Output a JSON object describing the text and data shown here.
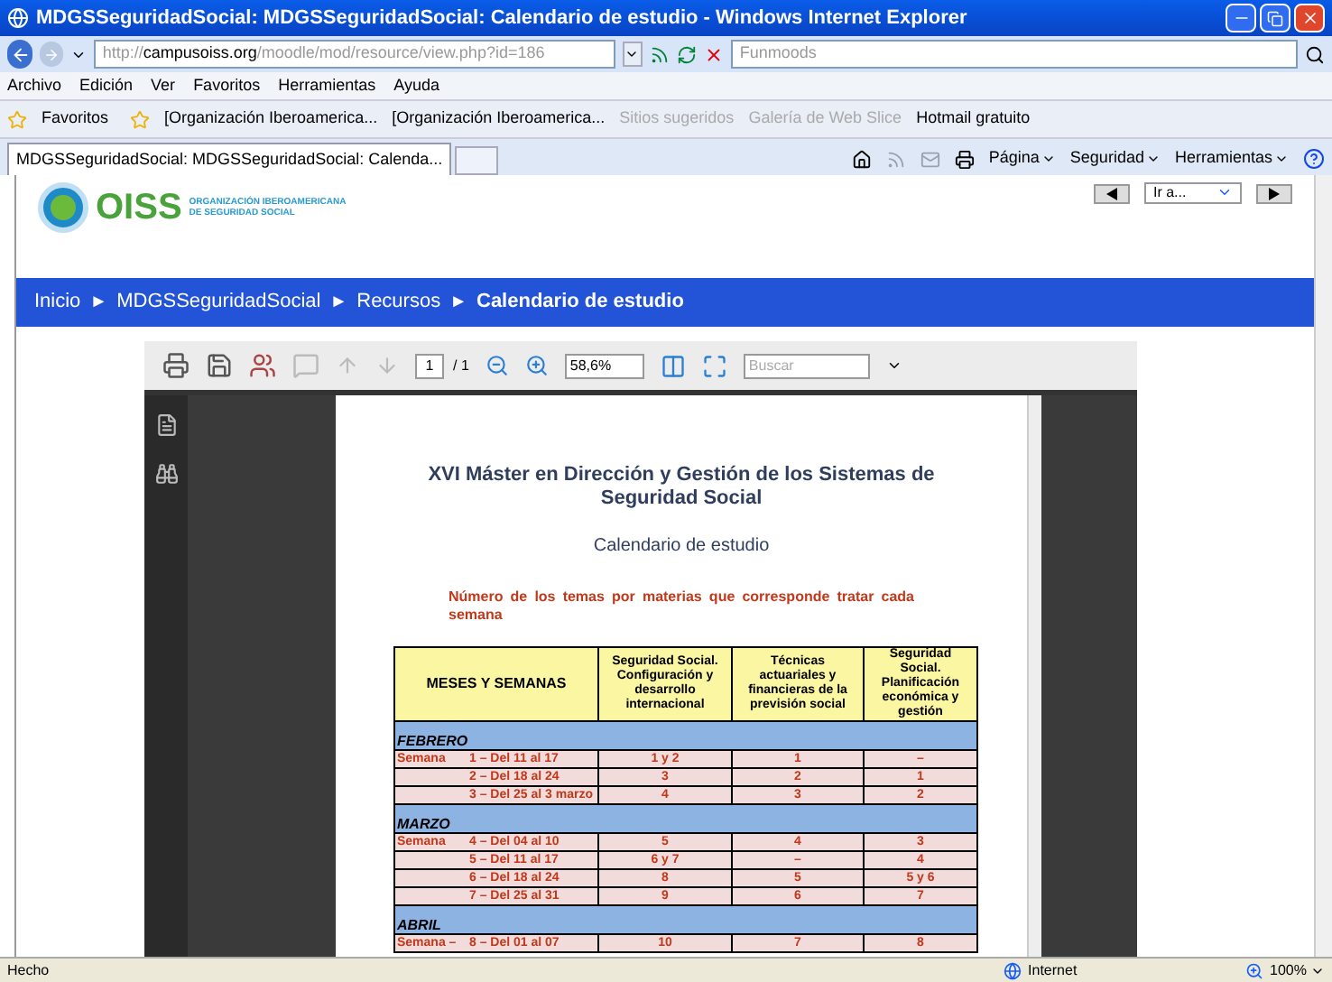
{
  "window": {
    "title": "MDGSSeguridadSocial: MDGSSeguridadSocial: Calendario de estudio - Windows Internet Explorer"
  },
  "address_bar": {
    "url_prefix": "http://",
    "url_host": "campusoiss.org",
    "url_path": "/moodle/mod/resource/view.php?id=186",
    "search_placeholder": "Funmoods"
  },
  "menu": [
    "Archivo",
    "Edición",
    "Ver",
    "Favoritos",
    "Herramientas",
    "Ayuda"
  ],
  "favorites_bar": {
    "label": "Favoritos",
    "items": [
      {
        "label": "[Organización Iberoamerica...",
        "disabled": false
      },
      {
        "label": "[Organización Iberoamerica...",
        "disabled": false
      },
      {
        "label": "Sitios sugeridos",
        "disabled": true
      },
      {
        "label": "Galería de Web Slice",
        "disabled": true
      },
      {
        "label": "Hotmail gratuito",
        "disabled": false
      }
    ]
  },
  "tabs": [
    {
      "label": "MDGSSeguridadSocial: MDGSSeguridadSocial: Calenda...",
      "selected": true
    }
  ],
  "command_bar": [
    "Página",
    "Seguridad",
    "Herramientas"
  ],
  "site": {
    "logo": "OISS",
    "logo_subtitle": [
      "ORGANIZACIÓN IBEROAMERICANA",
      "DE SEGURIDAD SOCIAL"
    ],
    "jump_menu": "Ir a...",
    "breadcrumb": [
      {
        "label": "Inicio",
        "current": false
      },
      {
        "label": "MDGSSeguridadSocial",
        "current": false
      },
      {
        "label": "Recursos",
        "current": false
      },
      {
        "label": "Calendario de estudio",
        "current": true
      }
    ],
    "separator": "►"
  },
  "pdf_toolbar": {
    "page": "1",
    "total": "/ 1",
    "zoom": "58,6%",
    "search_placeholder": "Buscar"
  },
  "document": {
    "title": "XVI Máster en Dirección y Gestión de los Sistemas de Seguridad Social",
    "subtitle": "Calendario de estudio",
    "note": "Número de los temas por materias que corresponde tratar cada semana",
    "table": {
      "columns": [
        "MESES Y SEMANAS",
        "Seguridad Social. Configuración y desarrollo internacional",
        "Técnicas actuariales y financieras de la previsión social",
        "Seguridad Social. Planificación económica y gestión"
      ],
      "sections": [
        {
          "month": "FEBRERO",
          "rows": [
            {
              "label": "Semana",
              "week": "1 – Del 11 al 17",
              "values": [
                "1 y 2",
                "1",
                "–"
              ]
            },
            {
              "week": "2 – Del 18 al 24",
              "values": [
                "3",
                "2",
                "1"
              ]
            },
            {
              "week": "3 – Del 25 al 3 marzo",
              "values": [
                "4",
                "3",
                "2"
              ]
            }
          ]
        },
        {
          "month": "MARZO",
          "rows": [
            {
              "label": "Semana",
              "week": "4 – Del 04 al 10",
              "values": [
                "5",
                "4",
                "3"
              ]
            },
            {
              "week": "5 – Del 11 al 17",
              "values": [
                "6 y 7",
                "–",
                "4"
              ]
            },
            {
              "week": "6 – Del 18 al 24",
              "values": [
                "8",
                "5",
                "5 y 6"
              ]
            },
            {
              "week": "7 – Del 25 al 31",
              "values": [
                "9",
                "6",
                "7"
              ]
            }
          ]
        },
        {
          "month": "ABRIL",
          "rows": [
            {
              "label": "Semana –",
              "week": "8 – Del 01 al 07",
              "values": [
                "10",
                "7",
                "8"
              ]
            }
          ]
        }
      ]
    }
  },
  "status_bar": {
    "status": "Hecho",
    "zone": "Internet",
    "zoom": "100%"
  }
}
